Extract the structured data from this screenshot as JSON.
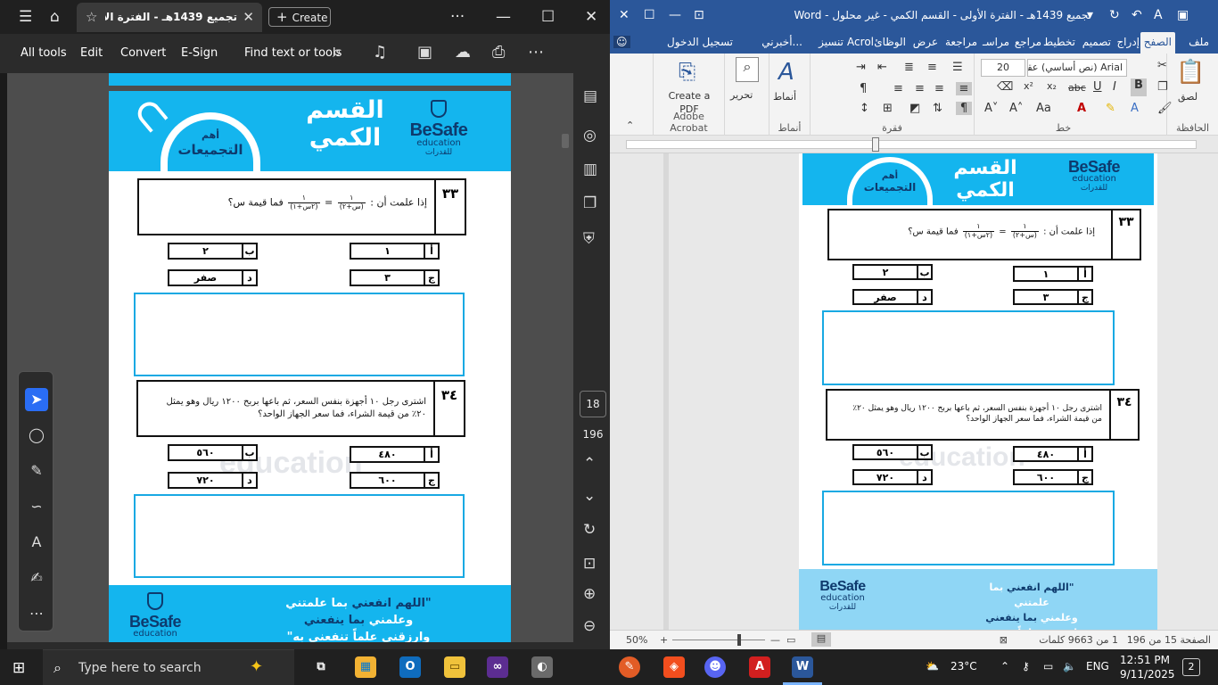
{
  "acrobat": {
    "tab_title": "تجميع 1439هـ - الفترة الأولى ..",
    "create_label": "Create",
    "more_menu": "···",
    "tools": {
      "all_tools": "All tools",
      "edit": "Edit",
      "convert": "Convert",
      "esign": "E-Sign",
      "find": "Find text or tools"
    },
    "page_number": "18",
    "page_total": "196"
  },
  "document": {
    "banner_title": "القسم الكمي",
    "banner_subtitle_top": "أهم",
    "banner_subtitle_main": "التجميعات",
    "logo_name": "BeSafe",
    "logo_sub": "education",
    "logo_ar": "للقدرات",
    "watermark": "education",
    "q33": {
      "number": "٣٣",
      "text_before": "إذا علمت أن :",
      "frac1_num": "١",
      "frac1_den": "(س+٢)",
      "equals": "=",
      "frac2_num": "١",
      "frac2_den": "(٢س+١)",
      "text_after": "فما قيمة س؟",
      "options": [
        {
          "letter": "أ",
          "value": "١"
        },
        {
          "letter": "ب",
          "value": "٢"
        },
        {
          "letter": "ج",
          "value": "٣"
        },
        {
          "letter": "د",
          "value": "صفر"
        }
      ]
    },
    "q34": {
      "number": "٣٤",
      "text": "اشترى رجل ١٠ أجهزة بنفس السعر، ثم باعها بربح ١٢٠٠ ريال وهو يمثل ٢٠٪ من قيمة الشراء، فما سعر الجهاز الواحد؟",
      "options": [
        {
          "letter": "أ",
          "value": "٤٨٠"
        },
        {
          "letter": "ب",
          "value": "٥٦٠"
        },
        {
          "letter": "ج",
          "value": "٦٠٠"
        },
        {
          "letter": "د",
          "value": "٧٢٠"
        }
      ]
    },
    "footer_line1_a": "\"اللهم",
    "footer_line1_b": "انفعني",
    "footer_line1_c": "بما علمتني",
    "footer_line2_a": "وعلمني",
    "footer_line2_b": "بما ينفعني",
    "footer_line3": "وارزقني علماً تنفعني به\""
  },
  "word": {
    "title": "تجميع 1439هـ - الفترة الأولى - القسم الكمي - غير محلول - Word",
    "tabs": [
      "ملف",
      "الصفح",
      "إدراج",
      "تصميم",
      "تخطيط",
      "مراجع",
      "مراسـ",
      "مراجعة",
      "عرض",
      "الوظائ",
      "Acrol",
      "تنسيز",
      "أخبرني...",
      "تسجيل الدخول"
    ],
    "groups": {
      "clipboard": "الحافظة",
      "font": "خط",
      "paragraph": "فقرة",
      "styles": "أنماط",
      "adobe": "Adobe Acrobat"
    },
    "font_name": "Arial (نص أساسي) عقد",
    "font_size": "20",
    "paste_label": "لصق",
    "styles_label": "أنماط",
    "editing_label": "تحرير",
    "create_pdf_label": "Create a PDF",
    "status_page": "الصفحة 15 من 196",
    "status_words": "1 من 9663 كلمات",
    "zoom": "50%"
  },
  "taskbar": {
    "search_placeholder": "Type here to search",
    "weather": "23°C",
    "language": "ENG",
    "time": "12:51 PM",
    "date": "9/11/2025",
    "notifications": "2"
  }
}
